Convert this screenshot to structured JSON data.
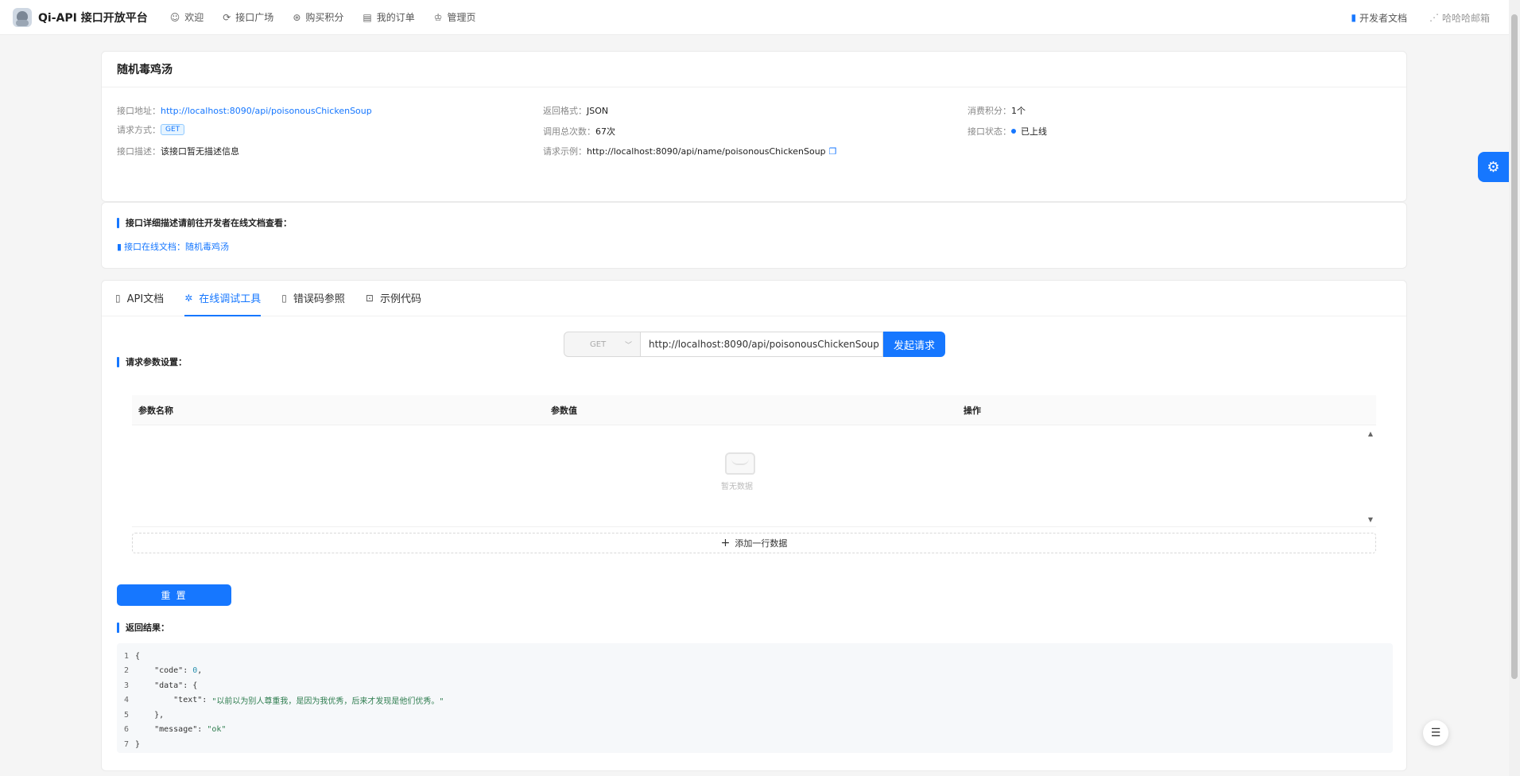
{
  "header": {
    "title": "Qi-API 接口开放平台",
    "nav": [
      {
        "icon": "smile-icon",
        "glyph": "☺",
        "label": "欢迎"
      },
      {
        "icon": "api-icon",
        "glyph": "⟳",
        "label": "接口广场"
      },
      {
        "icon": "coin-icon",
        "glyph": "⊛",
        "label": "购买积分"
      },
      {
        "icon": "order-icon",
        "glyph": "▤",
        "label": "我的订单"
      },
      {
        "icon": "crown-icon",
        "glyph": "♔",
        "label": "管理页"
      }
    ],
    "dev_docs": "开发者文档",
    "user": "哈哈哈邮箱"
  },
  "info": {
    "title": "随机毒鸡汤",
    "address_label": "接口地址：",
    "address": "http://localhost:8090/api/poisonousChickenSoup",
    "method_label": "请求方式：",
    "method": "GET",
    "desc_label": "接口描述：",
    "desc": "该接口暂无描述信息",
    "format_label": "返回格式：",
    "format": "JSON",
    "calls_label": "调用总次数：",
    "calls": "67次",
    "example_label": "请求示例：",
    "example": "http://localhost:8090/api/name/poisonousChickenSoup",
    "cost_label": "消费积分：",
    "cost": "1个",
    "status_label": "接口状态：",
    "status": "已上线"
  },
  "doc_section": {
    "title": "接口详细描述请前往开发者在线文档查看：",
    "link": "接口在线文档：随机毒鸡汤"
  },
  "tabs": [
    {
      "label": "API文档",
      "icon": "file-icon",
      "glyph": "▯",
      "active": false
    },
    {
      "label": "在线调试工具",
      "icon": "bug-icon",
      "glyph": "✲",
      "active": true
    },
    {
      "label": "错误码参照",
      "icon": "error-file-icon",
      "glyph": "▯",
      "active": false
    },
    {
      "label": "示例代码",
      "icon": "code-icon",
      "glyph": "⊡",
      "active": false
    }
  ],
  "request": {
    "method": "GET",
    "url": "http://localhost:8090/api/poisonousChickenSoup",
    "send": "发起请求"
  },
  "params": {
    "title": "请求参数设置：",
    "columns": [
      "参数名称",
      "参数值",
      "操作"
    ],
    "empty": "暂无数据",
    "add_row": "添加一行数据"
  },
  "reset": "重 置",
  "result": {
    "title": "返回结果：",
    "lines": [
      {
        "n": "1",
        "parts": [
          {
            "t": "{",
            "c": "k"
          }
        ]
      },
      {
        "n": "2",
        "parts": [
          {
            "t": "    \"code\": ",
            "c": "k"
          },
          {
            "t": "0",
            "c": "num"
          },
          {
            "t": ",",
            "c": "k"
          }
        ]
      },
      {
        "n": "3",
        "parts": [
          {
            "t": "    \"data\": {",
            "c": "k"
          }
        ]
      },
      {
        "n": "4",
        "parts": [
          {
            "t": "        \"text\": ",
            "c": "k"
          },
          {
            "t": "\"以前以为别人尊重我，是因为我优秀，后来才发现是他们优秀。\"",
            "c": "str"
          }
        ]
      },
      {
        "n": "5",
        "parts": [
          {
            "t": "    },",
            "c": "k"
          }
        ]
      },
      {
        "n": "6",
        "parts": [
          {
            "t": "    \"message\": ",
            "c": "k"
          },
          {
            "t": "\"ok\"",
            "c": "str"
          }
        ]
      },
      {
        "n": "7",
        "parts": [
          {
            "t": "}",
            "c": "k"
          }
        ]
      }
    ]
  },
  "colors": {
    "accent": "#1677ff"
  }
}
